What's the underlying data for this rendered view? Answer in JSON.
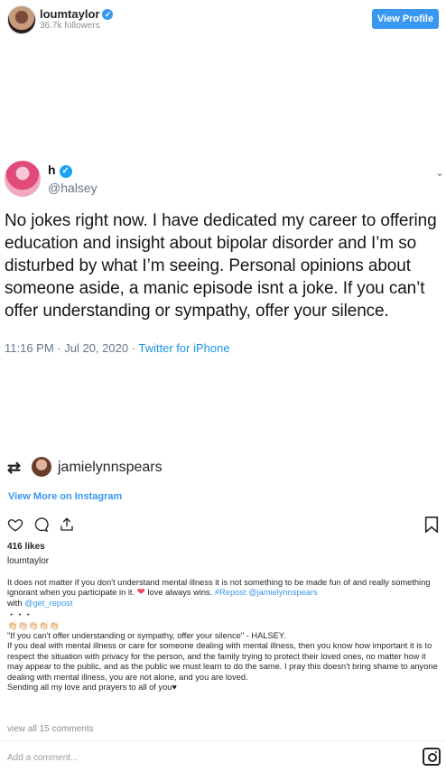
{
  "header": {
    "username": "loumtaylor",
    "followers": "36.7k followers",
    "view_profile": "View Profile"
  },
  "tweet": {
    "name": "h",
    "handle": "@halsey",
    "text": "No jokes right now. I have dedicated my career to offering education and insight about bipolar disorder and I’m so disturbed by what I’m seeing. Personal opinions about someone aside, a manic episode isnt a joke. If you can’t offer understanding or sympathy, offer your silence.",
    "time": "11:16 PM · Jul 20, 2020 ·",
    "source": "Twitter for iPhone"
  },
  "repost": {
    "username": "jamielynnspears"
  },
  "post": {
    "view_more": "View More on Instagram",
    "likes": "416 likes",
    "owner": "loumtaylor",
    "caption_1": "It does not matter if you don't understand mental illness it is not something to be made fun of and really something ignorant when you participate in it. ",
    "caption_1b": " love always wins. ",
    "hashtag": "#Repost",
    "mention_1": "@jamielynnspears",
    "with": "with ",
    "mention_2": "@get_repost",
    "dots": "・・・",
    "clap": "👏🏻👏🏻👏🏻👏🏻👏🏻",
    "quote": "\"If you can't offer understanding or sympathy, offer your silence\" - HALSEY.",
    "body": "If you deal with mental illness or care for someone dealing with mental illness, then you know how important it is to respect the situation with privacy for the person, and the family trying to protect their loved ones, no matter how it may appear to the public, and as the public we must learn to do the same. I pray this doesn't bring shame to anyone dealing with mental illness, you are not alone, and you are loved.",
    "sending": "Sending all my love and prayers to all of you♥",
    "view_all": "view all 15 comments",
    "add_comment": "Add a comment..."
  },
  "colors": {
    "accent": "#3897f0",
    "twitter_blue": "#1b95e0",
    "heart": "#ed4956"
  }
}
